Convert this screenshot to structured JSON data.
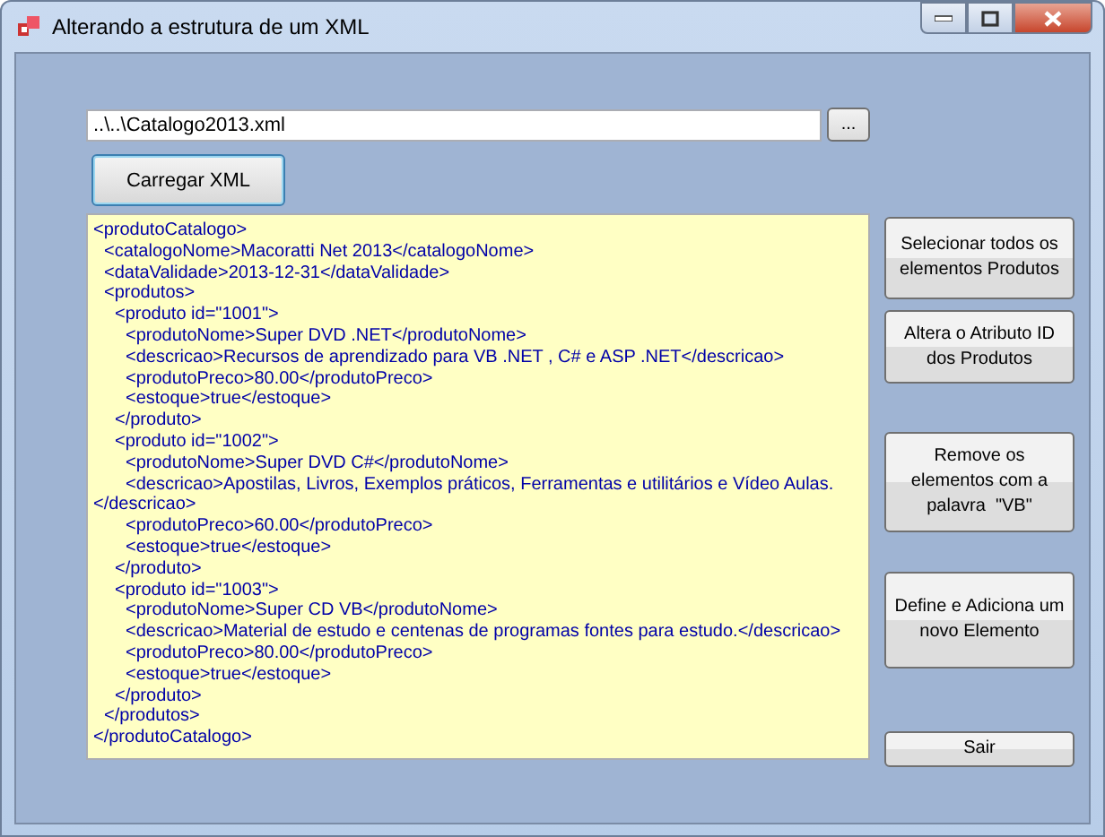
{
  "window": {
    "title": "Alterando a estrutura de um XML"
  },
  "file_path": {
    "value": "..\\..\\Catalogo2013.xml"
  },
  "browse_button": "...",
  "load_button": "Carregar XML",
  "xml_lines": [
    {
      "text": "<produtoCatalogo>",
      "children": [
        {
          "text": "<catalogoNome>Macoratti Net 2013</catalogoNome>"
        },
        {
          "text": "<dataValidade>2013-12-31</dataValidade>"
        },
        {
          "text": "<produtos>",
          "children": [
            {
              "text": "<produto id=\"1001\">",
              "children": [
                {
                  "text": "<produtoNome>Super DVD .NET</produtoNome>"
                },
                {
                  "text": "<descricao>Recursos de aprendizado para VB .NET , C# e ASP .NET</descricao>"
                },
                {
                  "text": "<produtoPreco>80.00</produtoPreco>"
                },
                {
                  "text": "<estoque>true</estoque>"
                }
              ]
            },
            {
              "text": "</produto>"
            },
            {
              "text": "<produto id=\"1002\">",
              "children": [
                {
                  "text": "<produtoNome>Super DVD C#</produtoNome>"
                },
                {
                  "text": "<descricao>Apostilas, Livros, Exemplos práticos, Ferramentas e utilitários e Vídeo Aulas.</descricao>"
                },
                {
                  "text": "<produtoPreco>60.00</produtoPreco>"
                },
                {
                  "text": "<estoque>true</estoque>"
                }
              ]
            },
            {
              "text": "</produto>"
            },
            {
              "text": "<produto id=\"1003\">",
              "children": [
                {
                  "text": "<produtoNome>Super CD VB</produtoNome>"
                },
                {
                  "text": "<descricao>Material de estudo e centenas de programas fontes para estudo.</descricao>"
                },
                {
                  "text": "<produtoPreco>80.00</produtoPreco>"
                },
                {
                  "text": "<estoque>true</estoque>"
                }
              ]
            },
            {
              "text": "</produto>"
            }
          ]
        },
        {
          "text": "</produtos>"
        }
      ]
    },
    {
      "text": "</produtoCatalogo>"
    }
  ],
  "action_buttons": [
    {
      "label": "Selecionar todos os elementos Produtos"
    },
    {
      "label": "Altera o Atributo ID dos Produtos"
    },
    {
      "label": "Remove os elementos com a palavra  \"VB\""
    },
    {
      "label": "Define e Adiciona um novo Elemento"
    },
    {
      "label": "Sair"
    }
  ]
}
